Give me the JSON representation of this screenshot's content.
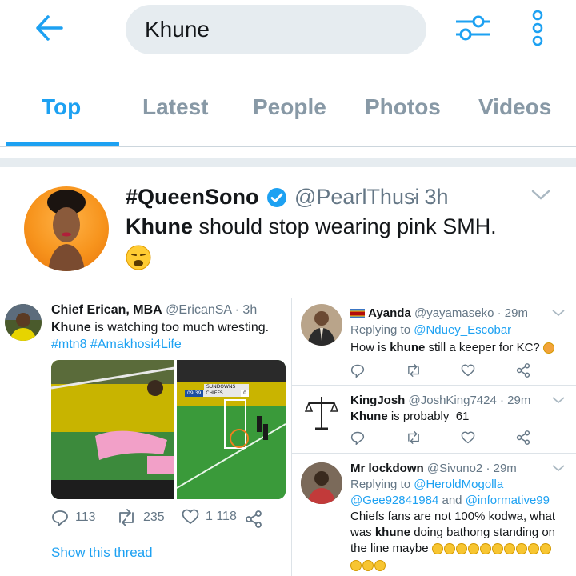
{
  "search": {
    "query": "Khune"
  },
  "tabs": [
    {
      "label": "Top"
    },
    {
      "label": "Latest"
    },
    {
      "label": "People"
    },
    {
      "label": "Photos"
    },
    {
      "label": "Videos"
    }
  ],
  "main_tweet": {
    "name": "#QueenSono",
    "handle": "@PearlThusi",
    "time": "· 3h",
    "text_bold": "Khune",
    "text_rest": " should stop wearing pink SMH."
  },
  "left_tweet": {
    "name": "Chief Erican, MBA",
    "handle": "@EricanSA",
    "time": "· 3h",
    "text_bold": "Khune",
    "text_rest": " is watching too much wresting.",
    "hashtags": "#mtn8 #Amakhosi4Life",
    "scoreboard_team1": "SUNDOWNS",
    "scoreboard_time": "09:39",
    "scoreboard_team2": "CHIEFS",
    "scoreboard_score": "0",
    "replies": "113",
    "retweets": "235",
    "likes": "1 118",
    "show_thread": "Show this thread"
  },
  "right_tweets": [
    {
      "name": "Ayanda",
      "handle": "@yayamaseko",
      "time": "· 29m",
      "replying_label": "Replying to ",
      "replying_to": "@Nduey_Escobar",
      "text_pre": "How is ",
      "text_bold": "khune",
      "text_post": " still a keeper for KC?"
    },
    {
      "name": "KingJosh",
      "handle": "@JoshKing7424",
      "time": "· 29m",
      "text_bold": "Khune",
      "text_post": " is probably  61"
    },
    {
      "name": "Mr lockdown",
      "handle": "@Sivuno2",
      "time": "· 29m",
      "replying_label": "Replying to ",
      "replying_to_1": "@HeroldMogolla",
      "replying_to_2": "@Gee92841984",
      "replying_and": " and ",
      "replying_to_3": "@informative99",
      "line1": "Chiefs fans are not 100% kodwa, what",
      "line2_pre": "was ",
      "line2_bold": "khune",
      "line2_post": " doing bathong standing on",
      "line3": "the line maybe"
    }
  ],
  "colors": {
    "accent": "#1da1f2",
    "muted": "#657786",
    "tab_inactive": "#8899a6"
  }
}
